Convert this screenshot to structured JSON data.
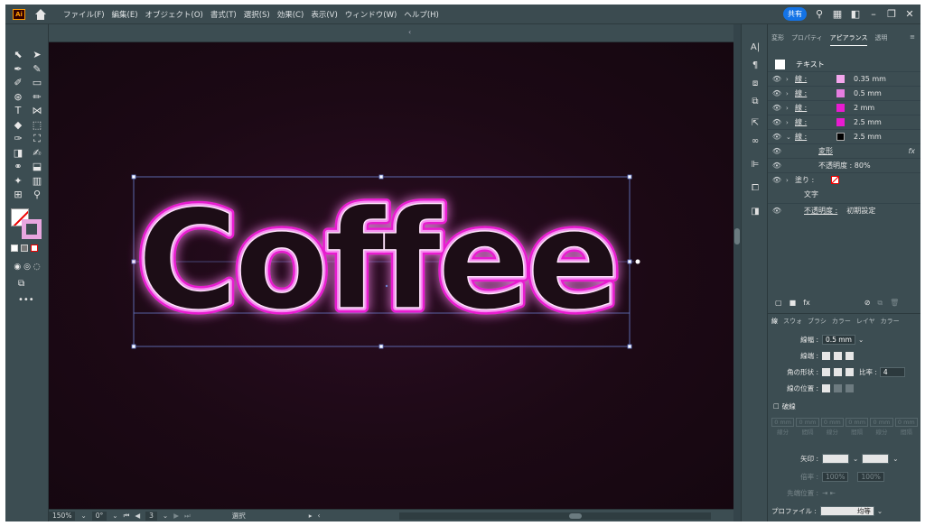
{
  "app": {
    "logo_text": "Ai"
  },
  "menu": [
    "ファイル(F)",
    "編集(E)",
    "オブジェクト(O)",
    "書式(T)",
    "選択(S)",
    "効果(C)",
    "表示(V)",
    "ウィンドウ(W)",
    "ヘルプ(H)"
  ],
  "topbar": {
    "share_label": "共有"
  },
  "canvas": {
    "text": "Coffee",
    "neon_color": "#ff2fd8",
    "background_color": "#1a0a12"
  },
  "status": {
    "zoom": "150%",
    "rotation": "0°",
    "artboard": "3",
    "mode": "選択"
  },
  "panel": {
    "tabs": [
      "変形",
      "プロパティ",
      "アピアランス",
      "透明"
    ],
    "active_tab": "アピアランス",
    "header": "テキスト",
    "strokes": [
      {
        "label": "線 :",
        "value": "0.35 mm",
        "color": "#f3a6ec"
      },
      {
        "label": "線 :",
        "value": "0.5 mm",
        "color": "#e67de0"
      },
      {
        "label": "線 :",
        "value": "2 mm",
        "color": "#e81bd0"
      },
      {
        "label": "線 :",
        "value": "2.5 mm",
        "color": "#e81bd0"
      },
      {
        "label": "線 :",
        "value": "2.5 mm",
        "color": "#000000"
      }
    ],
    "effect": "変形",
    "opacity_row": "不透明度 :  80%",
    "fill_label": "塗り :",
    "text_label": "文字",
    "opacity_label": "不透明度 :",
    "opacity_value": "初期設定",
    "fx_symbol": "fx"
  },
  "stroke_panel": {
    "tabs": [
      "線",
      "スウォ",
      "ブラシ",
      "カラー",
      "レイヤ",
      "カラー"
    ],
    "weight_label": "線幅 :",
    "weight_value": "0.5 mm",
    "cap_label": "線端 :",
    "corner_label": "角の形状 :",
    "ratio_label": "比率 :",
    "ratio_value": "4",
    "align_label": "線の位置 :",
    "dashed_label": "破線",
    "dash_cells": [
      "0 mm",
      "0 mm",
      "0 mm",
      "0 mm",
      "0 mm",
      "0 mm"
    ],
    "dash_cell_labels": [
      "線分",
      "間隔",
      "線分",
      "間隔",
      "線分",
      "間隔"
    ],
    "arrow_label": "矢印 :",
    "scale_label": "倍率 :",
    "scale_value_1": "100%",
    "scale_value_2": "100%",
    "tip_label": "先端位置 :",
    "profile_label": "プロファイル :",
    "profile_value": "均等"
  }
}
